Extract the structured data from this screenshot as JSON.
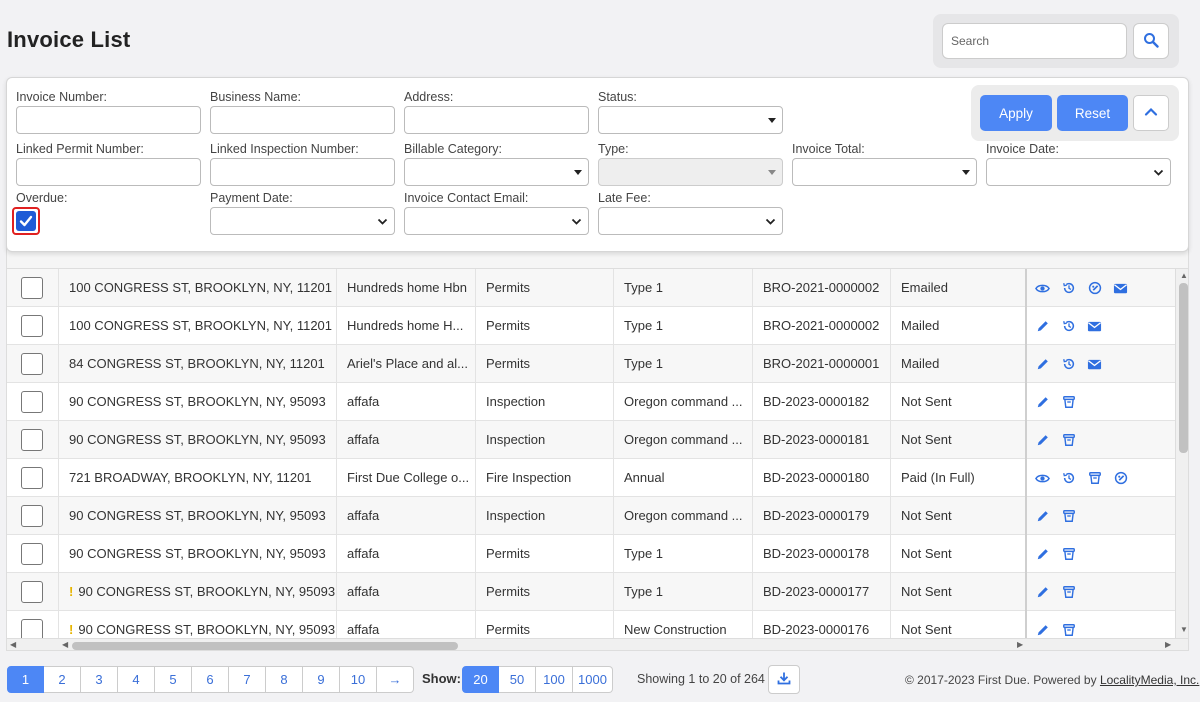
{
  "page": {
    "title": "Invoice List"
  },
  "search": {
    "placeholder": "Search"
  },
  "filters": {
    "invoice_number": "Invoice Number:",
    "business_name": "Business Name:",
    "address": "Address:",
    "status": "Status:",
    "linked_permit_number": "Linked Permit Number:",
    "linked_inspection_number": "Linked Inspection Number:",
    "billable_category": "Billable Category:",
    "type": "Type:",
    "invoice_total": "Invoice Total:",
    "invoice_date": "Invoice Date:",
    "overdue": "Overdue:",
    "overdue_checked": true,
    "payment_date": "Payment Date:",
    "invoice_contact_email": "Invoice Contact Email:",
    "late_fee": "Late Fee:",
    "apply_label": "Apply",
    "reset_label": "Reset"
  },
  "table": {
    "rows": [
      {
        "address": "100 CONGRESS ST, BROOKLYN, NY, 11201",
        "business": "Hundreds home Hbn",
        "category": "Permits",
        "type": "Type 1",
        "invoice_no": "BRO-2021-0000002",
        "status": "Emailed",
        "warning": false,
        "actions": [
          "view-icon",
          "history-icon",
          "payment-icon",
          "email-icon"
        ]
      },
      {
        "address": "100 CONGRESS ST, BROOKLYN, NY, 11201",
        "business": "Hundreds home H...",
        "category": "Permits",
        "type": "Type 1",
        "invoice_no": "BRO-2021-0000002",
        "status": "Mailed",
        "warning": false,
        "actions": [
          "edit-icon",
          "history-icon",
          "email-icon"
        ]
      },
      {
        "address": "84 CONGRESS ST, BROOKLYN, NY, 11201",
        "business": "Ariel's Place and al...",
        "category": "Permits",
        "type": "Type 1",
        "invoice_no": "BRO-2021-0000001",
        "status": "Mailed",
        "warning": false,
        "actions": [
          "edit-icon",
          "history-icon",
          "email-icon"
        ]
      },
      {
        "address": "90 CONGRESS ST, BROOKLYN, NY, 95093",
        "business": "affafa",
        "category": "Inspection",
        "type": "Oregon command ...",
        "invoice_no": "BD-2023-0000182",
        "status": "Not Sent",
        "warning": false,
        "actions": [
          "edit-icon",
          "delete-icon"
        ]
      },
      {
        "address": "90 CONGRESS ST, BROOKLYN, NY, 95093",
        "business": "affafa",
        "category": "Inspection",
        "type": "Oregon command ...",
        "invoice_no": "BD-2023-0000181",
        "status": "Not Sent",
        "warning": false,
        "actions": [
          "edit-icon",
          "delete-icon"
        ]
      },
      {
        "address": "721 BROADWAY, BROOKLYN, NY, 11201",
        "business": "First Due College o...",
        "category": "Fire Inspection",
        "type": "Annual",
        "invoice_no": "BD-2023-0000180",
        "status": "Paid (In Full)",
        "warning": false,
        "actions": [
          "view-icon",
          "history-icon",
          "delete-icon",
          "payment-icon"
        ]
      },
      {
        "address": "90 CONGRESS ST, BROOKLYN, NY, 95093",
        "business": "affafa",
        "category": "Inspection",
        "type": "Oregon command ...",
        "invoice_no": "BD-2023-0000179",
        "status": "Not Sent",
        "warning": false,
        "actions": [
          "edit-icon",
          "delete-icon"
        ]
      },
      {
        "address": "90 CONGRESS ST, BROOKLYN, NY, 95093",
        "business": "affafa",
        "category": "Permits",
        "type": "Type 1",
        "invoice_no": "BD-2023-0000178",
        "status": "Not Sent",
        "warning": false,
        "actions": [
          "edit-icon",
          "delete-icon"
        ]
      },
      {
        "address": "90 CONGRESS ST, BROOKLYN, NY, 95093",
        "business": "affafa",
        "category": "Permits",
        "type": "Type 1",
        "invoice_no": "BD-2023-0000177",
        "status": "Not Sent",
        "warning": true,
        "actions": [
          "edit-icon",
          "delete-icon"
        ]
      },
      {
        "address": "90 CONGRESS ST, BROOKLYN, NY, 95093",
        "business": "affafa",
        "category": "Permits",
        "type": "New Construction",
        "invoice_no": "BD-2023-0000176",
        "status": "Not Sent",
        "warning": true,
        "actions": [
          "edit-icon",
          "delete-icon"
        ]
      }
    ]
  },
  "pagination": {
    "pages": [
      "1",
      "2",
      "3",
      "4",
      "5",
      "6",
      "7",
      "8",
      "9",
      "10",
      "→"
    ],
    "active_page": "1",
    "show_label": "Show:",
    "sizes": [
      "20",
      "50",
      "100",
      "1000"
    ],
    "active_size": "20",
    "showing_text": "Showing 1 to 20 of 264"
  },
  "footer": {
    "copyright": "© 2017-2023 First Due. Powered by",
    "link_text": "LocalityMedia, Inc."
  },
  "colors": {
    "accent": "#4d87f5",
    "icon": "#2f6fe0",
    "warning": "#e6b400",
    "checkbox_highlight": "#e02020"
  }
}
